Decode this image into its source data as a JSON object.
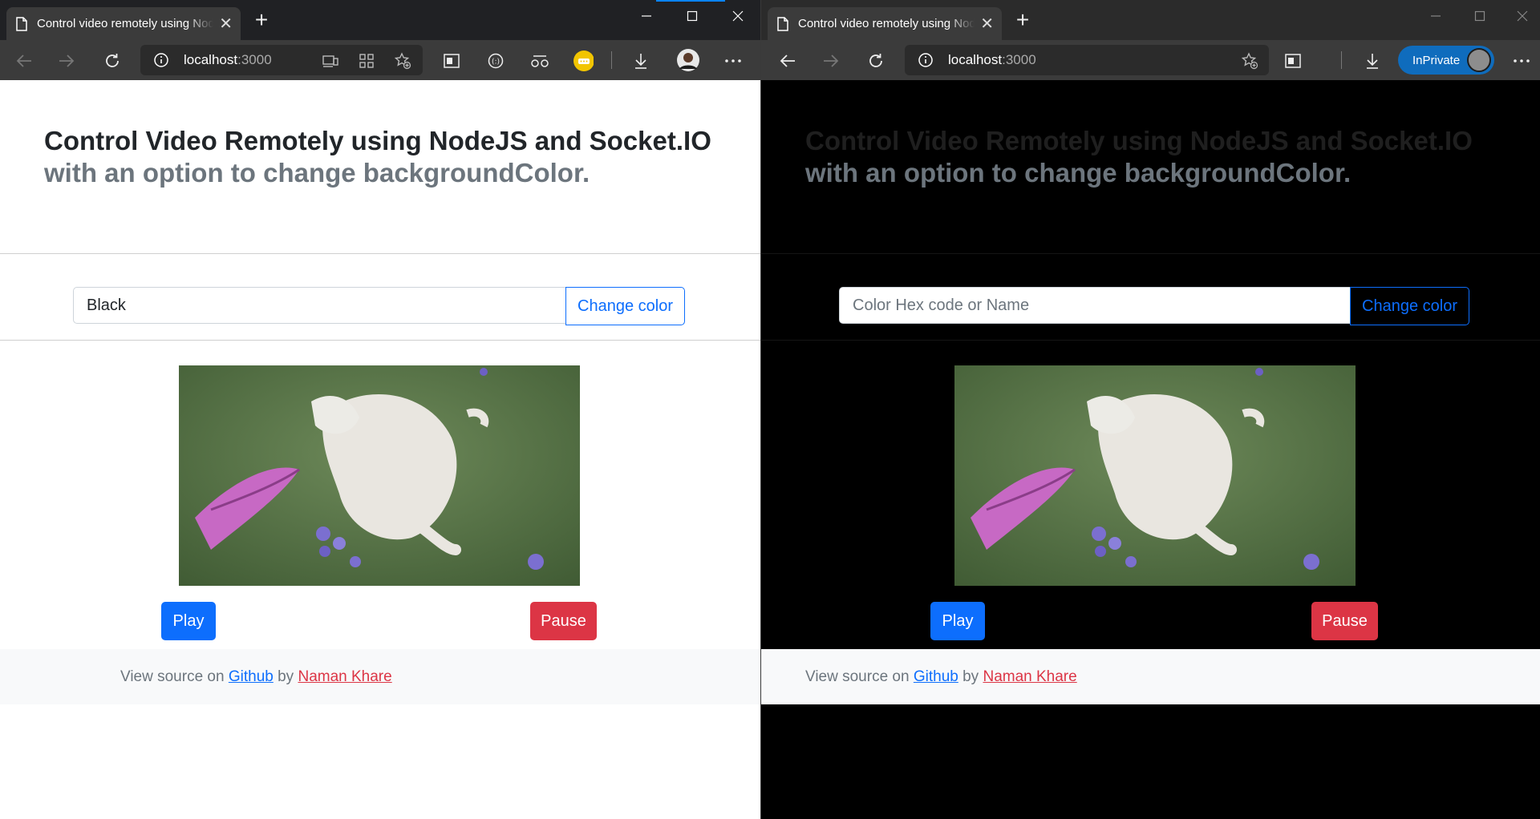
{
  "left_window": {
    "tab_title": "Control video remotely using NodeJS and Socket.IO",
    "address": {
      "host": "localhost",
      "port": ":3000"
    },
    "page": {
      "heading_main": "Control Video Remotely using NodeJS and Socket.IO",
      "heading_muted": "with an option to change backgroundColor.",
      "color_input_value": "Black",
      "change_color_label": "Change color",
      "play_label": "Play",
      "pause_label": "Pause",
      "footer": {
        "prefix": "View source on",
        "link": "Github",
        "by": "by",
        "author": "Naman Khare"
      }
    }
  },
  "right_window": {
    "tab_title": "Control video remotely using NodeJS and Socket.IO",
    "address": {
      "host": "localhost",
      "port": ":3000"
    },
    "inprivate_label": "InPrivate",
    "page": {
      "heading_main": "Control Video Remotely using NodeJS and Socket.IO",
      "heading_muted": "with an option to change backgroundColor.",
      "color_input_placeholder": "Color Hex code or Name",
      "change_color_label": "Change color",
      "play_label": "Play",
      "pause_label": "Pause",
      "footer": {
        "prefix": "View source on",
        "link": "Github",
        "by": "by",
        "author": "Naman Khare"
      }
    }
  },
  "colors": {
    "primary": "#0d6efd",
    "danger": "#dc3545",
    "right_page_background": "#000000",
    "left_page_background": "#ffffff",
    "inprivate_badge": "#0f6cbd"
  },
  "icons": [
    "page-icon",
    "close-icon",
    "plus-icon",
    "minimize-icon",
    "maximize-icon",
    "back-icon",
    "forward-icon",
    "refresh-icon",
    "info-icon",
    "app-available-icon",
    "apps-icon",
    "add-favorite-icon",
    "split-screen-icon",
    "collections-icon",
    "immersive-reader-icon",
    "extension-icon",
    "download-icon",
    "profile-avatar",
    "more-icon"
  ]
}
